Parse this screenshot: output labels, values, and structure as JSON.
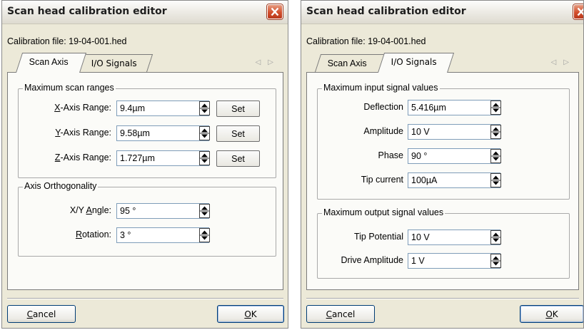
{
  "windows": [
    {
      "title": "Scan head calibration editor",
      "calibration_file": "Calibration file: 19-04-001.hed",
      "tabs": [
        {
          "label": "Scan Axis",
          "active": true
        },
        {
          "label": "I/O Signals",
          "active": false
        }
      ],
      "group_scan": {
        "title": "Maximum  scan ranges",
        "rows": [
          {
            "key": "X",
            "rest": "-Axis Range:",
            "value": "9.4µm",
            "button": "Set"
          },
          {
            "key": "Y",
            "rest": "-Axis Range:",
            "value": "9.58µm",
            "button": "Set"
          },
          {
            "key": "Z",
            "rest": "-Axis Range:",
            "value": "1.727µm",
            "button": "Set"
          }
        ]
      },
      "group_ortho": {
        "title": "Axis Orthogonality",
        "rows": [
          {
            "pre": "X/Y ",
            "key": "A",
            "rest": "ngle:",
            "value": "95 °"
          },
          {
            "pre": "",
            "key": "R",
            "rest": "otation:",
            "value": "3 °"
          }
        ]
      },
      "cancel": {
        "key": "C",
        "rest": "ancel"
      },
      "ok": {
        "key": "O",
        "rest": "K"
      }
    },
    {
      "title": "Scan head calibration editor",
      "calibration_file": "Calibration file: 19-04-001.hed",
      "tabs": [
        {
          "label": "Scan Axis",
          "active": false
        },
        {
          "label": "I/O Signals",
          "active": true
        }
      ],
      "group_input": {
        "title": "Maximum input signal values",
        "rows": [
          {
            "label": "Deflection",
            "value": "5.416µm"
          },
          {
            "label": "Amplitude",
            "value": "10 V"
          },
          {
            "label": "Phase",
            "value": "90 °"
          },
          {
            "label": "Tip current",
            "value": "100µA"
          }
        ]
      },
      "group_output": {
        "title": "Maximum output signal values",
        "rows": [
          {
            "label": "Tip Potential",
            "value": "10 V"
          },
          {
            "label": "Drive Amplitude",
            "value": "1 V"
          }
        ]
      },
      "cancel": {
        "key": "C",
        "rest": "ancel"
      },
      "ok": {
        "key": "O",
        "rest": "K"
      }
    }
  ]
}
